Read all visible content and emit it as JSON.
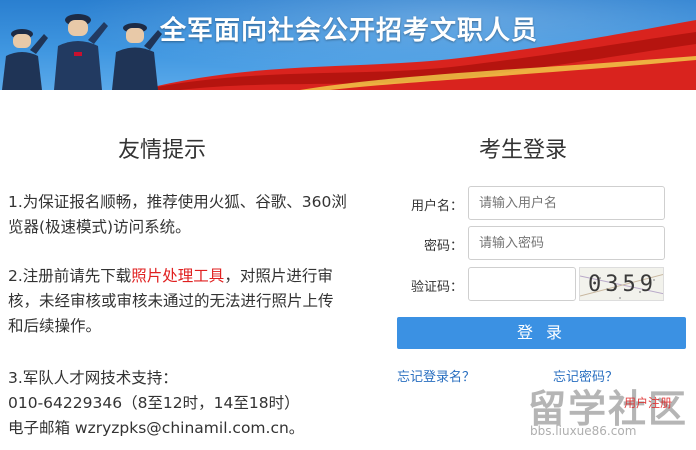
{
  "banner": {
    "title": "全军面向社会公开招考文职人员"
  },
  "tips": {
    "heading": "友情提示",
    "tip1": "1.为保证报名顺畅，推荐使用火狐、谷歌、360浏览器(极速模式)访问系统。",
    "tip2_before": "2.注册前请先下载",
    "tip2_link": "照片处理工具",
    "tip2_after": "，对照片进行审核，未经审核或审核未通过的无法进行照片上传和后续操作。",
    "tip3_line1": "3.军队人才网技术支持：",
    "tip3_line2": "010-64229346（8至12时，14至18时）",
    "tip3_line3": "电子邮箱 wzryzpks@chinamil.com.cn。"
  },
  "login": {
    "heading": "考生登录",
    "username_label": "用户名：",
    "username_placeholder": "请输入用户名",
    "password_label": "密码：",
    "password_placeholder": "请输入密码",
    "captcha_label": "验证码：",
    "captcha_text": "0359",
    "submit_label": "登 录",
    "forgot_username": "忘记登录名？",
    "forgot_password": "忘记密码？"
  },
  "watermark": {
    "big": "留学社区",
    "small": "bbs.liuxue86.com",
    "red": "用户注册"
  },
  "colors": {
    "accent": "#3b91e3",
    "link": "#2a6fc0",
    "highlight_link": "#e02020",
    "banner_red": "#d9231e"
  }
}
